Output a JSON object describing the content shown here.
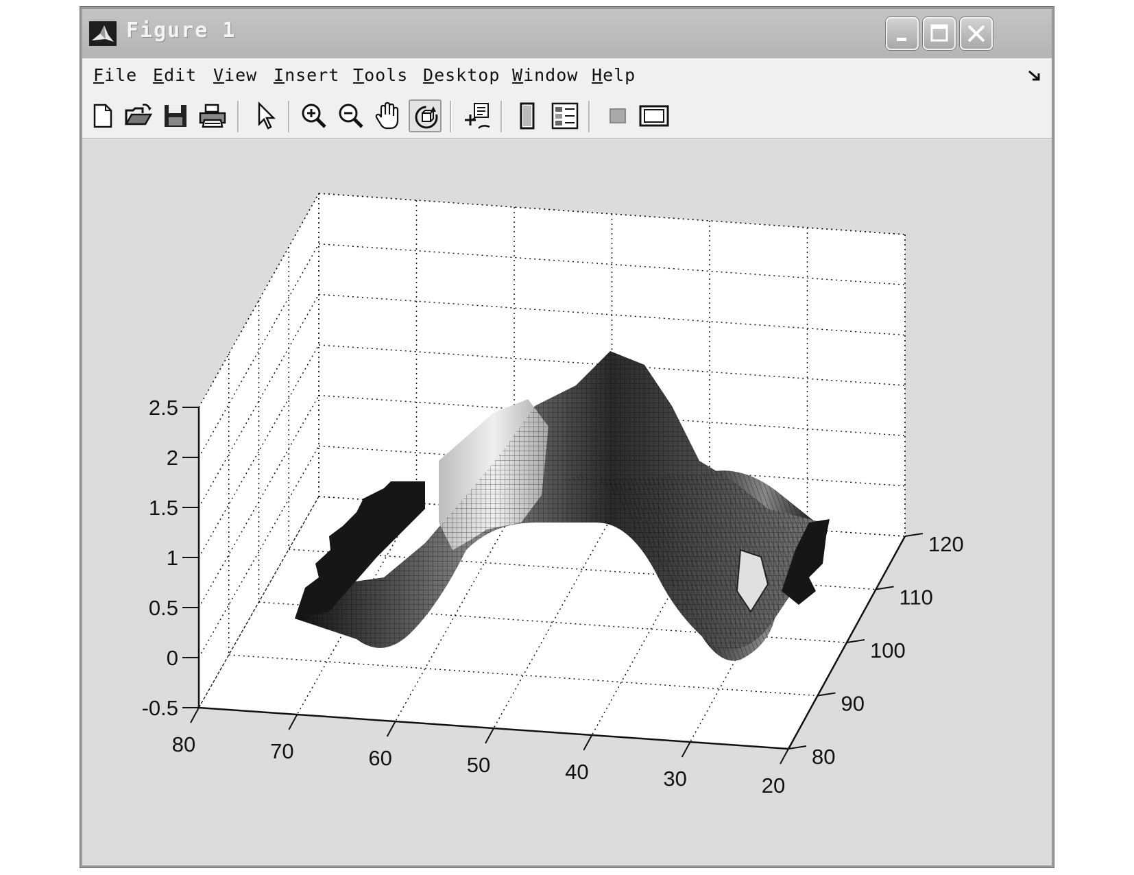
{
  "window": {
    "title": "Figure 1",
    "controls": {
      "minimize": "minimize",
      "maximize": "maximize",
      "close": "close"
    }
  },
  "menu": {
    "items": [
      {
        "mnemonic": "F",
        "rest": "ile"
      },
      {
        "mnemonic": "E",
        "rest": "dit"
      },
      {
        "mnemonic": "V",
        "rest": "iew"
      },
      {
        "mnemonic": "I",
        "rest": "nsert"
      },
      {
        "mnemonic": "T",
        "rest": "ools"
      },
      {
        "mnemonic": "D",
        "rest": "esktop"
      },
      {
        "mnemonic": "W",
        "rest": "indow"
      },
      {
        "mnemonic": "H",
        "rest": "elp"
      }
    ]
  },
  "toolbar": {
    "icons": [
      "new-file-icon",
      "open-folder-icon",
      "save-icon",
      "print-icon",
      "select-arrow-icon",
      "zoom-in-icon",
      "zoom-out-icon",
      "pan-hand-icon",
      "rotate-3d-icon",
      "data-cursor-icon",
      "colorbar-icon",
      "legend-icon",
      "hide-plot-tools-icon",
      "show-plot-tools-icon"
    ],
    "pressed": "rotate-3d-icon"
  },
  "chart_data": {
    "type": "surface",
    "title": "",
    "xlabel": "",
    "ylabel": "",
    "zlabel": "",
    "x_ticks": [
      "80",
      "70",
      "60",
      "50",
      "40",
      "30",
      "20"
    ],
    "y_ticks": [
      "80",
      "90",
      "100",
      "110",
      "120"
    ],
    "z_ticks": [
      "2.5",
      "2",
      "1.5",
      "1",
      "0.5",
      "0",
      "-0.5"
    ],
    "xlim": [
      20,
      80
    ],
    "ylim": [
      80,
      120
    ],
    "zlim": [
      -0.5,
      2.5
    ],
    "grid": true,
    "colormap": "gray",
    "surface_peak_z": 2.6
  },
  "colors": {
    "window_frame": "#9a9a9a",
    "figure_bg": "#dcdcdc",
    "axes_bg": "#ffffff",
    "surface_dark": "#1a1a1a",
    "surface_light": "#d8d8d8"
  }
}
